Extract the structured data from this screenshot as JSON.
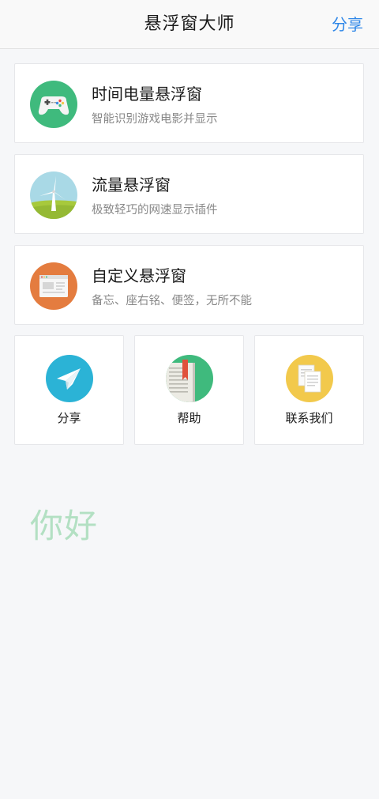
{
  "header": {
    "title": "悬浮窗大师",
    "share_label": "分享"
  },
  "cards": [
    {
      "title": "时间电量悬浮窗",
      "desc": "智能识别游戏电影并显示",
      "icon": "gamepad-icon",
      "color": "#3fba7d"
    },
    {
      "title": "流量悬浮窗",
      "desc": "极致轻巧的网速显示插件",
      "icon": "windmill-icon",
      "color": "#a9d9e6"
    },
    {
      "title": "自定义悬浮窗",
      "desc": "备忘、座右铭、便签，无所不能",
      "icon": "browser-window-icon",
      "color": "#e47c3f"
    }
  ],
  "tiles": [
    {
      "label": "分享",
      "icon": "paper-plane-icon",
      "color": "#2bb3d6"
    },
    {
      "label": "帮助",
      "icon": "book-icon",
      "color": "#3fba7d"
    },
    {
      "label": "联系我们",
      "icon": "documents-icon",
      "color": "#f2c94c"
    }
  ],
  "greeting": "你好"
}
